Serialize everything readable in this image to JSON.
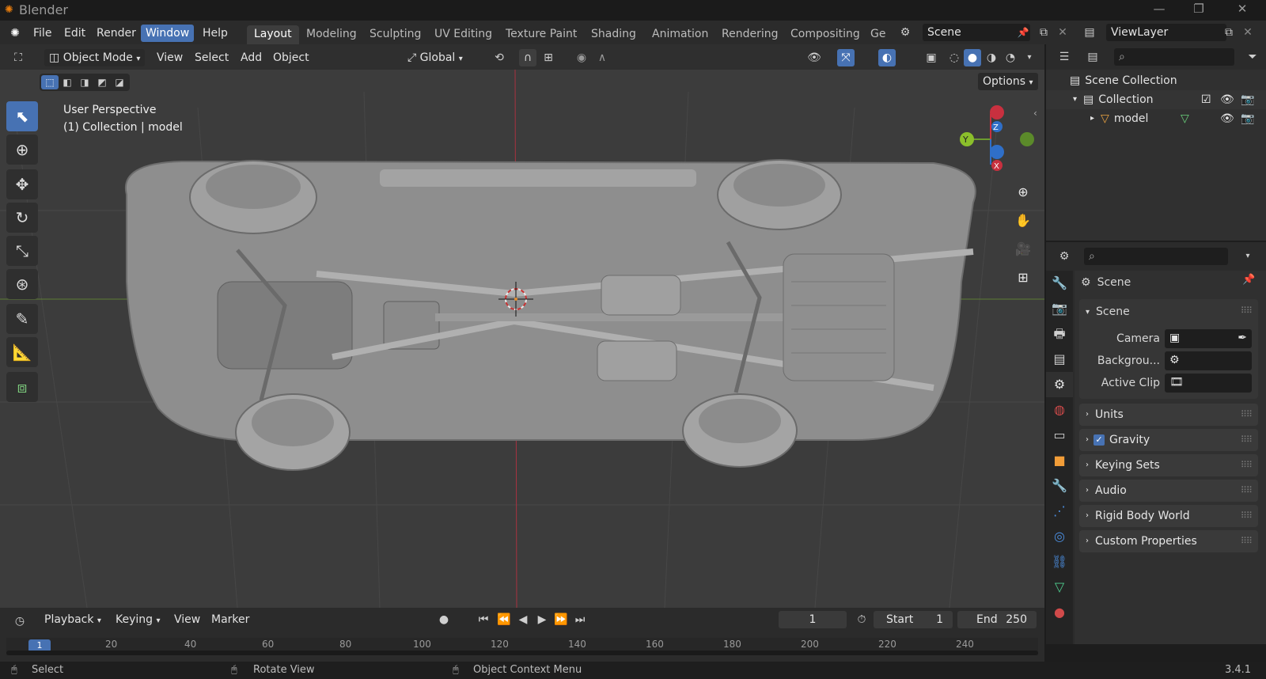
{
  "app": {
    "title": "Blender",
    "version": "3.4.1"
  },
  "menu": [
    "File",
    "Edit",
    "Render",
    "Window",
    "Help"
  ],
  "active_menu": "Window",
  "workspaces": [
    "Layout",
    "Modeling",
    "Sculpting",
    "UV Editing",
    "Texture Paint",
    "Shading",
    "Animation",
    "Rendering",
    "Compositing",
    "Ge"
  ],
  "active_workspace": "Layout",
  "scene_field": "Scene",
  "viewlayer_field": "ViewLayer",
  "viewport_header": {
    "mode": "Object Mode",
    "menus": [
      "View",
      "Select",
      "Add",
      "Object"
    ],
    "transform_orientation": "Global",
    "options_label": "Options"
  },
  "viewport_overlay": {
    "line1": "User Perspective",
    "line2": "(1) Collection | model"
  },
  "gizmo_labels": {
    "z": "Z",
    "y": "Y",
    "x": "X"
  },
  "outliner": {
    "root": "Scene Collection",
    "collection": "Collection",
    "object": "model"
  },
  "properties": {
    "context": "Scene",
    "section": "Scene",
    "fields": [
      {
        "label": "Camera"
      },
      {
        "label": "Backgrou..."
      },
      {
        "label": "Active Clip"
      }
    ],
    "panels": [
      "Units",
      "Gravity",
      "Keying Sets",
      "Audio",
      "Rigid Body World",
      "Custom Properties"
    ],
    "gravity_checked": true
  },
  "timeline": {
    "menus": [
      "Playback",
      "Keying",
      "View",
      "Marker"
    ],
    "current_frame": "1",
    "start_label": "Start",
    "start_value": "1",
    "end_label": "End",
    "end_value": "250",
    "ruler_ticks": [
      "1",
      "20",
      "40",
      "60",
      "80",
      "100",
      "120",
      "140",
      "160",
      "180",
      "200",
      "220",
      "240"
    ]
  },
  "status": {
    "select": "Select",
    "rotate": "Rotate View",
    "context_menu": "Object Context Menu"
  },
  "colors": {
    "accent": "#4772b3",
    "axis_x": "#c8303f",
    "axis_y": "#6d9c2f",
    "axis_z": "#2f6fc8",
    "viewport_bg": "#3c3c3c"
  }
}
